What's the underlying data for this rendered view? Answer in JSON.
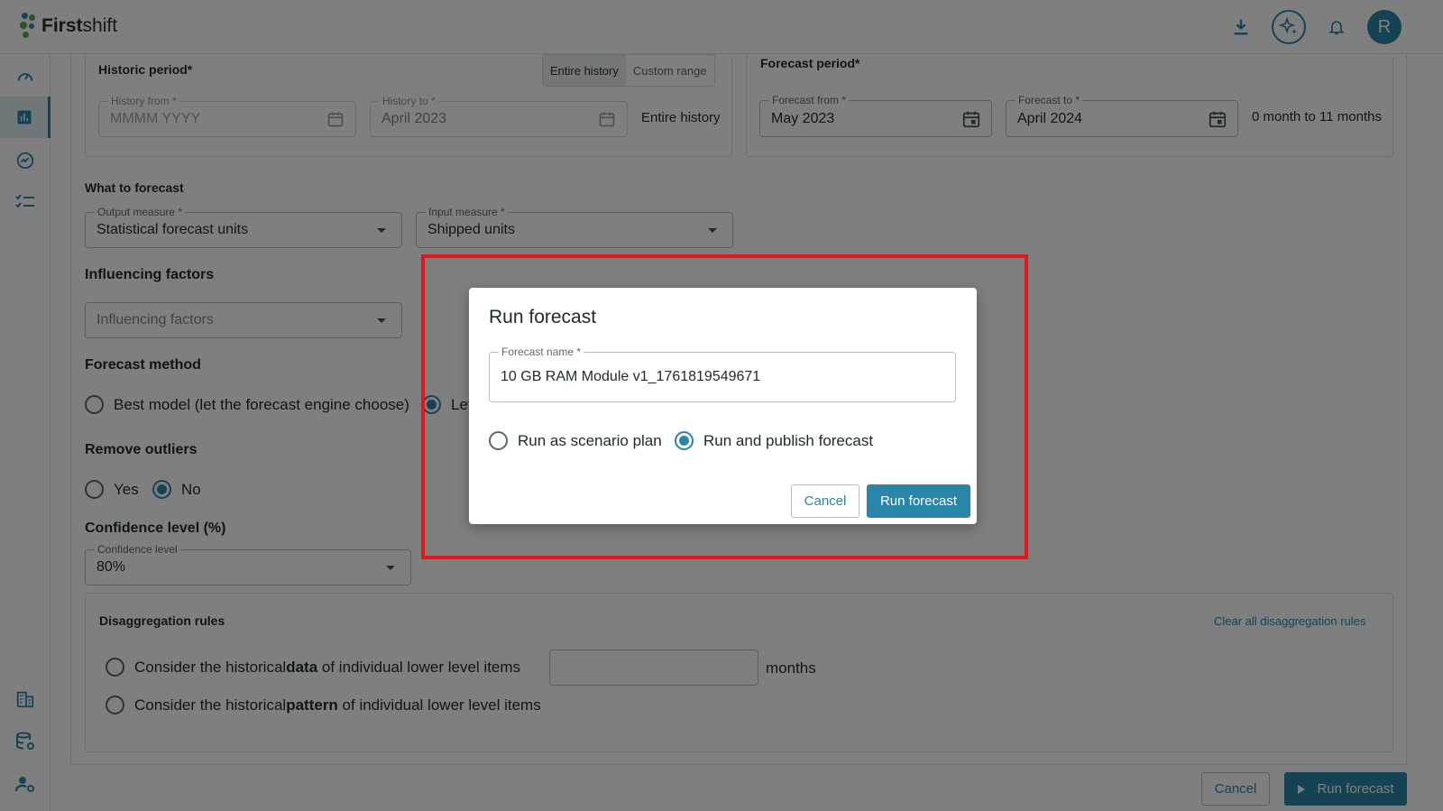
{
  "app": {
    "logo_bold": "First",
    "logo_regular": "shift",
    "avatar_initial": "R",
    "accent_color": "#2a86a8"
  },
  "header_icons": [
    "download-icon",
    "ai-sparkle-icon",
    "bell-icon"
  ],
  "sidebar": {
    "items": [
      {
        "icon": "dashboard-gauge-icon",
        "active": false
      },
      {
        "icon": "bar-chart-icon",
        "active": true
      },
      {
        "icon": "trend-icon",
        "active": false
      },
      {
        "icon": "checklist-icon",
        "active": false
      },
      {
        "icon": "building-icon",
        "active": false
      },
      {
        "icon": "database-settings-icon",
        "active": false
      },
      {
        "icon": "user-settings-icon",
        "active": false
      }
    ]
  },
  "historic": {
    "title": "Historic period*",
    "toggle": {
      "entire": "Entire history",
      "custom": "Custom range",
      "selected": "entire"
    },
    "from": {
      "label": "History from *",
      "placeholder": "MMMM YYYY"
    },
    "to": {
      "label": "History to *",
      "value": "April 2023"
    },
    "summary": "Entire history"
  },
  "forecast_period": {
    "title": "Forecast period*",
    "from": {
      "label": "Forecast from *",
      "value": "May 2023"
    },
    "to": {
      "label": "Forecast to *",
      "value": "April 2024"
    },
    "summary": "0 month to 11 months"
  },
  "what_to_forecast": {
    "title": "What to forecast",
    "output": {
      "label": "Output measure *",
      "value": "Statistical forecast units"
    },
    "input": {
      "label": "Input measure *",
      "value": "Shipped units"
    }
  },
  "influencing": {
    "title": "Influencing factors",
    "placeholder": "Influencing factors"
  },
  "method": {
    "title": "Forecast method",
    "options": [
      "Best model (let the forecast engine choose)",
      "Let"
    ],
    "selected": 1
  },
  "outliers": {
    "title": "Remove outliers",
    "yes": "Yes",
    "no": "No",
    "selected": "No"
  },
  "confidence": {
    "title": "Confidence level (%)",
    "label": "Confidence level",
    "value": "80%"
  },
  "disaggregation": {
    "title": "Disaggregation rules",
    "clear": "Clear all disaggregation rules",
    "opt1_pre": "Consider the historical ",
    "opt1_bold": "data",
    "opt1_post": " of individual lower level items",
    "months": "months",
    "opt2_pre": "Consider the historical ",
    "opt2_bold": "pattern",
    "opt2_post": " of individual lower level items"
  },
  "footer": {
    "cancel": "Cancel",
    "run": "Run forecast"
  },
  "modal": {
    "title": "Run forecast",
    "name_label": "Forecast name *",
    "name_value": "10 GB RAM Module v1_1761819549671",
    "opt_scenario": "Run as scenario plan",
    "opt_publish": "Run and publish forecast",
    "selected": "publish",
    "cancel": "Cancel",
    "run": "Run forecast"
  }
}
